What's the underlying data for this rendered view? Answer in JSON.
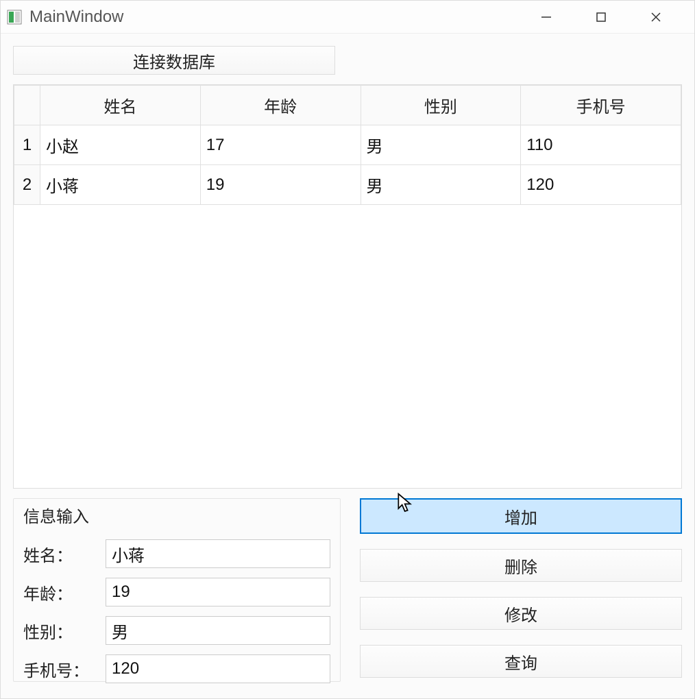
{
  "window": {
    "title": "MainWindow"
  },
  "connect_button": "连接数据库",
  "table": {
    "headers": [
      "姓名",
      "年龄",
      "性别",
      "手机号"
    ],
    "rows": [
      {
        "idx": "1",
        "cells": [
          "小赵",
          "17",
          "男",
          "110"
        ]
      },
      {
        "idx": "2",
        "cells": [
          "小蒋",
          "19",
          "男",
          "120"
        ]
      }
    ]
  },
  "form": {
    "group_title": "信息输入",
    "fields": [
      {
        "label": "姓名：",
        "value": "小蒋"
      },
      {
        "label": "年龄：",
        "value": "19"
      },
      {
        "label": "性别：",
        "value": "男"
      },
      {
        "label": "手机号：",
        "value": "120"
      }
    ]
  },
  "actions": {
    "add": "增加",
    "delete": "删除",
    "modify": "修改",
    "query": "查询"
  }
}
